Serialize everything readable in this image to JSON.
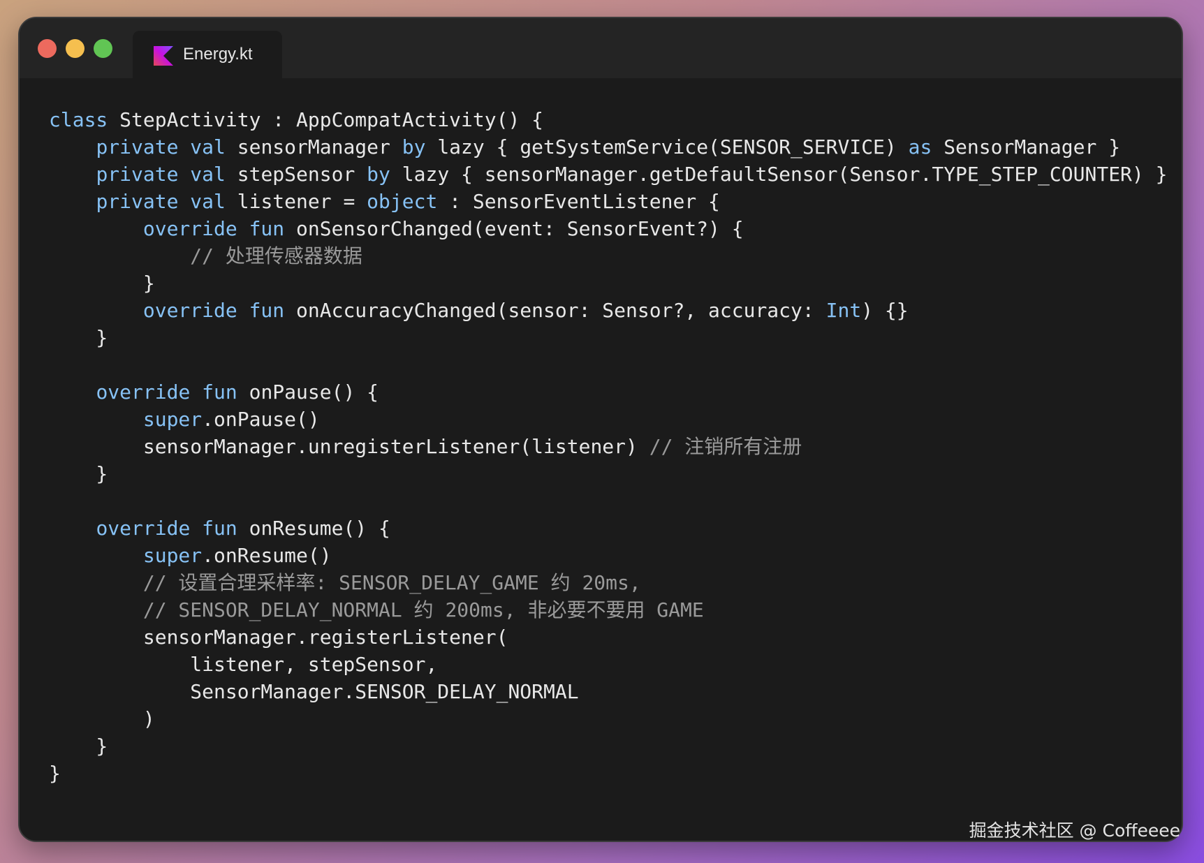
{
  "window": {
    "title_tab": "Energy.kt",
    "file_icon": "kotlin-icon",
    "traffic_lights": {
      "close": "#ed6a5e",
      "minimize": "#f5bf4f",
      "zoom": "#61c554"
    }
  },
  "colors": {
    "background_gradient": [
      "#c9a27e",
      "#a86fc0",
      "#8a4de0"
    ],
    "editor_bg": "#1b1b1b",
    "titlebar_bg": "#242424",
    "keyword": "#87c2f5",
    "text": "#e8e8e8",
    "comment": "#9a9a9a"
  },
  "code": {
    "lines": [
      [
        [
          "kw",
          "class"
        ],
        [
          "tx",
          " StepActivity : AppCompatActivity() {"
        ]
      ],
      [
        [
          "tx",
          "    "
        ],
        [
          "kw",
          "private val"
        ],
        [
          "tx",
          " sensorManager "
        ],
        [
          "kw",
          "by"
        ],
        [
          "tx",
          " lazy { getSystemService(SENSOR_SERVICE) "
        ],
        [
          "kw",
          "as"
        ],
        [
          "tx",
          " SensorManager }"
        ]
      ],
      [
        [
          "tx",
          "    "
        ],
        [
          "kw",
          "private val"
        ],
        [
          "tx",
          " stepSensor "
        ],
        [
          "kw",
          "by"
        ],
        [
          "tx",
          " lazy { sensorManager.getDefaultSensor(Sensor.TYPE_STEP_COUNTER) }"
        ]
      ],
      [
        [
          "tx",
          "    "
        ],
        [
          "kw",
          "private val"
        ],
        [
          "tx",
          " listener = "
        ],
        [
          "kw",
          "object"
        ],
        [
          "tx",
          " : SensorEventListener {"
        ]
      ],
      [
        [
          "tx",
          "        "
        ],
        [
          "kw",
          "override fun"
        ],
        [
          "tx",
          " onSensorChanged(event: SensorEvent?) {"
        ]
      ],
      [
        [
          "tx",
          "            "
        ],
        [
          "cm",
          "// 处理传感器数据"
        ]
      ],
      [
        [
          "tx",
          "        }"
        ]
      ],
      [
        [
          "tx",
          "        "
        ],
        [
          "kw",
          "override fun"
        ],
        [
          "tx",
          " onAccuracyChanged(sensor: Sensor?, accuracy: "
        ],
        [
          "kw",
          "Int"
        ],
        [
          "tx",
          ") {}"
        ]
      ],
      [
        [
          "tx",
          "    }"
        ]
      ],
      [],
      [
        [
          "tx",
          "    "
        ],
        [
          "kw",
          "override fun"
        ],
        [
          "tx",
          " onPause() {"
        ]
      ],
      [
        [
          "tx",
          "        "
        ],
        [
          "kw",
          "super"
        ],
        [
          "tx",
          ".onPause()"
        ]
      ],
      [
        [
          "tx",
          "        sensorManager.unregisterListener(listener) "
        ],
        [
          "cm",
          "// 注销所有注册"
        ]
      ],
      [
        [
          "tx",
          "    }"
        ]
      ],
      [],
      [
        [
          "tx",
          "    "
        ],
        [
          "kw",
          "override fun"
        ],
        [
          "tx",
          " onResume() {"
        ]
      ],
      [
        [
          "tx",
          "        "
        ],
        [
          "kw",
          "super"
        ],
        [
          "tx",
          ".onResume()"
        ]
      ],
      [
        [
          "tx",
          "        "
        ],
        [
          "cm",
          "// 设置合理采样率: SENSOR_DELAY_GAME 约 20ms,"
        ]
      ],
      [
        [
          "tx",
          "        "
        ],
        [
          "cm",
          "// SENSOR_DELAY_NORMAL 约 200ms, 非必要不要用 GAME"
        ]
      ],
      [
        [
          "tx",
          "        sensorManager.registerListener("
        ]
      ],
      [
        [
          "tx",
          "            listener, stepSensor,"
        ]
      ],
      [
        [
          "tx",
          "            SensorManager.SENSOR_DELAY_NORMAL"
        ]
      ],
      [
        [
          "tx",
          "        )"
        ]
      ],
      [
        [
          "tx",
          "    }"
        ]
      ],
      [
        [
          "tx",
          "}"
        ]
      ]
    ]
  },
  "watermark": "掘金技术社区 @ Coffeeee"
}
